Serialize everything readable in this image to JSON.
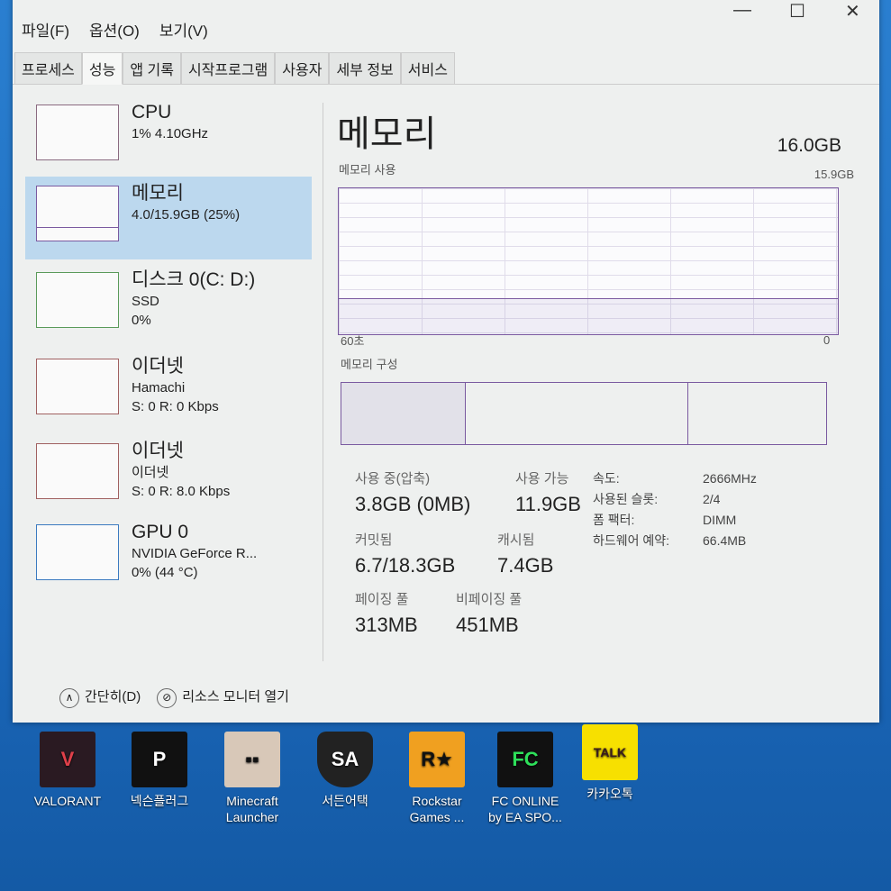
{
  "window": {
    "controls": {
      "minimize": "—",
      "maximize": "☐",
      "close": "✕"
    }
  },
  "menu": [
    "파일(F)",
    "옵션(O)",
    "보기(V)"
  ],
  "tabs": [
    "프로세스",
    "성능",
    "앱 기록",
    "시작프로그램",
    "사용자",
    "세부 정보",
    "서비스"
  ],
  "active_tab": "성능",
  "sidebar": [
    {
      "title": "CPU",
      "l1": "1% 4.10GHz",
      "l2": ""
    },
    {
      "title": "메모리",
      "l1": "4.0/15.9GB (25%)",
      "l2": "",
      "selected": true
    },
    {
      "title": "디스크 0(C: D:)",
      "l1": "SSD",
      "l2": "0%"
    },
    {
      "title": "이더넷",
      "l1": "Hamachi",
      "l2": "S: 0 R: 0 Kbps"
    },
    {
      "title": "이더넷",
      "l1": "이더넷",
      "l2": "S: 0 R: 8.0 Kbps"
    },
    {
      "title": "GPU 0",
      "l1": "NVIDIA GeForce R...",
      "l2": "0% (44 °C)"
    }
  ],
  "main": {
    "title": "메모리",
    "total": "16.0GB",
    "usage_label": "메모리 사용",
    "usage_max": "15.9GB",
    "axis_left": "60초",
    "axis_right": "0",
    "usage_fraction": 0.25,
    "composition_label": "메모리 구성",
    "stats": {
      "in_use_label": "사용 중(압축)",
      "in_use": "3.8GB (0MB)",
      "available_label": "사용 가능",
      "available": "11.9GB",
      "committed_label": "커밋됨",
      "committed": "6.7/18.3GB",
      "cached_label": "캐시됨",
      "cached": "7.4GB",
      "paged_label": "페이징 풀",
      "paged": "313MB",
      "nonpaged_label": "비페이징 풀",
      "nonpaged": "451MB"
    },
    "details": [
      {
        "k": "속도:",
        "v": "2666MHz"
      },
      {
        "k": "사용된 슬롯:",
        "v": "2/4"
      },
      {
        "k": "폼 팩터:",
        "v": "DIMM"
      },
      {
        "k": "하드웨어 예약:",
        "v": "66.4MB"
      }
    ]
  },
  "footer": {
    "fewer": "간단히(D)",
    "resmon": "리소스 모니터 열기"
  },
  "desktop": [
    "VALORANT",
    "넥슨플러그",
    "Minecraft Launcher",
    "서든어택",
    "Rockstar Games ...",
    "FC ONLINE by EA SPO...",
    "카카오톡"
  ],
  "colors": {
    "memory": "#7a5aa0",
    "selected": "#bcd8ee",
    "desktop": "#1f6fc0"
  }
}
